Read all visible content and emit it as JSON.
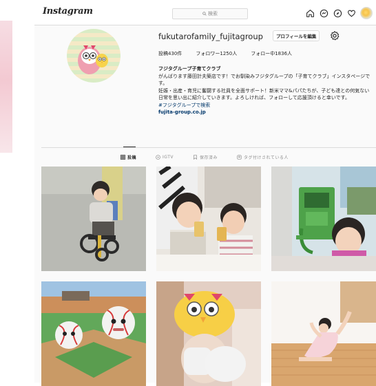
{
  "app": {
    "logo": "Instagram"
  },
  "search": {
    "placeholder": "検索",
    "icon": "search-icon"
  },
  "nav_icons": [
    "home-icon",
    "messenger-icon",
    "explore-icon",
    "heart-icon",
    "profile-avatar"
  ],
  "profile": {
    "username": "fukutarofamily_fujitagroup",
    "edit_button": "プロフィールを編集",
    "stats": {
      "posts": "投稿430件",
      "followers": "フォロワー1250人",
      "following": "フォロー中1836人"
    },
    "bio": {
      "name": "フジタグループ子育てクラブ",
      "lines": [
        "がんばります藤田計夫築店です！でお馴染みフジタグループの「子育てクラブ」インスタページです。",
        "妊娠・出産・育児に奮闘する社員を全面サポート！新米ママ&パパたちが、子ども達との何気ない日常を思い出に紹介していきます。よろしければ、フォローして応援頂けると幸いです。"
      ],
      "hashtag": "#フジタグループで検索",
      "link": "fujita-group.co.jp"
    }
  },
  "tabs": [
    {
      "label": "投稿",
      "icon": "grid-icon",
      "active": true
    },
    {
      "label": "IGTV",
      "icon": "igtv-icon",
      "active": false
    },
    {
      "label": "保存済み",
      "icon": "bookmark-icon",
      "active": false
    },
    {
      "label": "タグ付けされている人",
      "icon": "tag-icon",
      "active": false
    }
  ],
  "posts": [
    "post-child-tricycle",
    "post-kids-drinking",
    "post-girl-payphone",
    "post-baseball-stadium",
    "post-owl-mascot",
    "post-girl-stretching"
  ],
  "colors": {
    "border": "#dbdbdb",
    "link": "#00376b",
    "text": "#262626",
    "muted": "#8e8e8e"
  }
}
